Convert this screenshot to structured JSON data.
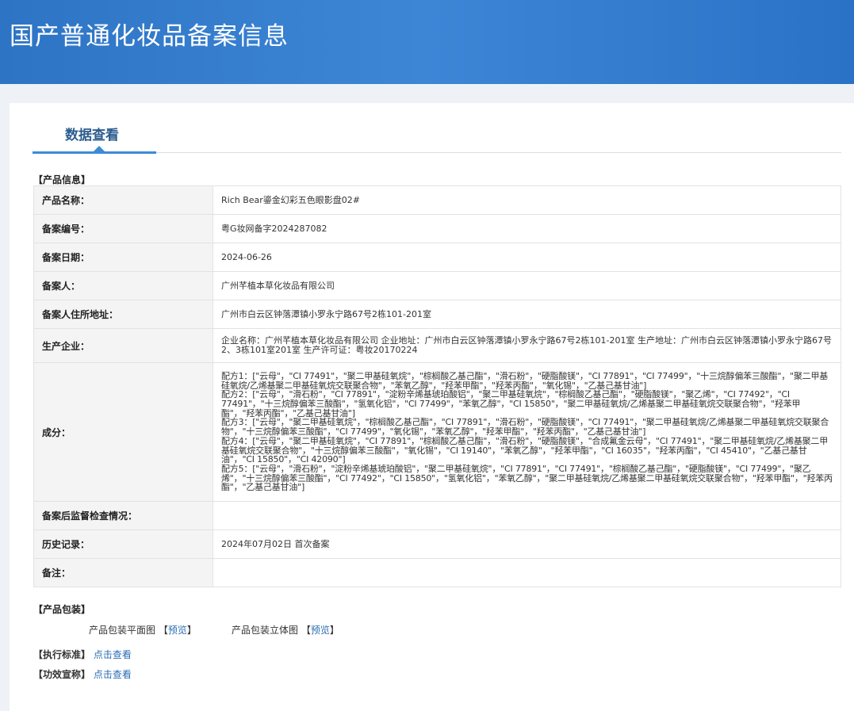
{
  "header": {
    "title": "国产普通化妆品备案信息"
  },
  "tab": {
    "label": "数据查看"
  },
  "product_info": {
    "section_title": "【产品信息】",
    "rows": [
      {
        "label": "产品名称：",
        "value": "Rich Bear鎏金幻彩五色眼影盘02#"
      },
      {
        "label": "备案编号：",
        "value": "粤G妆网备字2024287082"
      },
      {
        "label": "备案日期：",
        "value": "2024-06-26"
      },
      {
        "label": "备案人：",
        "value": "广州芊植本草化妆品有限公司"
      },
      {
        "label": "备案人住所地址：",
        "value": "广州市白云区钟落潭镇小罗永宁路67号2栋101-201室"
      },
      {
        "label": "生产企业：",
        "value": "企业名称：广州芊植本草化妆品有限公司 企业地址：广州市白云区钟落潭镇小罗永宁路67号2栋101-201室 生产地址：广州市白云区钟落潭镇小罗永宁路67号2、3栋101室201室 生产许可证：粤妆20170224"
      },
      {
        "label": "成分：",
        "formulas": [
          "配方1：[\"云母\"，\"CI 77491\"，\"聚二甲基硅氧烷\"，\"棕榈酸乙基己酯\"，\"滑石粉\"，\"硬脂酸镁\"，\"CI 77891\"，\"CI 77499\"，\"十三烷醇偏苯三酸酯\"，\"聚二甲基硅氧烷/乙烯基聚二甲基硅氧烷交联聚合物\"，\"苯氧乙醇\"，\"羟苯甲酯\"，\"羟苯丙酯\"，\"氧化锡\"，\"乙基己基甘油\"]",
          "配方2：[\"云母\"，\"滑石粉\"，\"CI 77891\"，\"淀粉辛烯基琥珀酸铝\"，\"聚二甲基硅氧烷\"，\"棕榈酸乙基己酯\"，\"硬脂酸镁\"，\"聚乙烯\"，\"CI 77492\"，\"CI 77491\"，\"十三烷醇偏苯三酸酯\"，\"氢氧化铝\"，\"CI 77499\"，\"苯氧乙醇\"，\"CI 15850\"，\"聚二甲基硅氧烷/乙烯基聚二甲基硅氧烷交联聚合物\"，\"羟苯甲酯\"，\"羟苯丙酯\"，\"乙基己基甘油\"]",
          "配方3：[\"云母\"，\"聚二甲基硅氧烷\"，\"棕榈酸乙基己酯\"，\"CI 77891\"，\"滑石粉\"，\"硬脂酸镁\"，\"CI 77491\"，\"聚二甲基硅氧烷/乙烯基聚二甲基硅氧烷交联聚合物\"，\"十三烷醇偏苯三酸酯\"，\"CI 77499\"，\"氧化锡\"，\"苯氧乙醇\"，\"羟苯甲酯\"，\"羟苯丙酯\"，\"乙基己基甘油\"]",
          "配方4：[\"云母\"，\"聚二甲基硅氧烷\"，\"CI 77891\"，\"棕榈酸乙基己酯\"，\"滑石粉\"，\"硬脂酸镁\"，\"合成氟金云母\"，\"CI 77491\"，\"聚二甲基硅氧烷/乙烯基聚二甲基硅氧烷交联聚合物\"，\"十三烷醇偏苯三酸酯\"，\"氧化锡\"，\"CI 19140\"，\"苯氧乙醇\"，\"羟苯甲酯\"，\"CI 16035\"，\"羟苯丙酯\"，\"CI 45410\"，\"乙基己基甘油\"，\"CI 15850\"，\"CI 42090\"]",
          "配方5：[\"云母\"，\"滑石粉\"，\"淀粉辛烯基琥珀酸铝\"，\"聚二甲基硅氧烷\"，\"CI 77891\"，\"CI 77491\"，\"棕榈酸乙基己酯\"，\"硬脂酸镁\"，\"CI 77499\"，\"聚乙烯\"，\"十三烷醇偏苯三酸酯\"，\"CI 77492\"，\"CI 15850\"，\"氢氧化铝\"，\"苯氧乙醇\"，\"聚二甲基硅氧烷/乙烯基聚二甲基硅氧烷交联聚合物\"，\"羟苯甲酯\"，\"羟苯丙酯\"，\"乙基己基甘油\"]"
        ]
      },
      {
        "label": "备案后监督检查情况：",
        "value": ""
      },
      {
        "label": "历史记录：",
        "value": "2024年07月02日 首次备案"
      },
      {
        "label": "备注：",
        "value": ""
      }
    ]
  },
  "packaging": {
    "section_title": "【产品包装】",
    "flat_label": "产品包装平面图",
    "flat_link": "预览",
    "solid_label": "产品包装立体图",
    "solid_link": "预览",
    "bracket_open": "【",
    "bracket_close": "】"
  },
  "standard": {
    "label": "【执行标准】",
    "link": "点击查看"
  },
  "efficacy": {
    "label": "【功效宣称】",
    "link": "点击查看"
  }
}
